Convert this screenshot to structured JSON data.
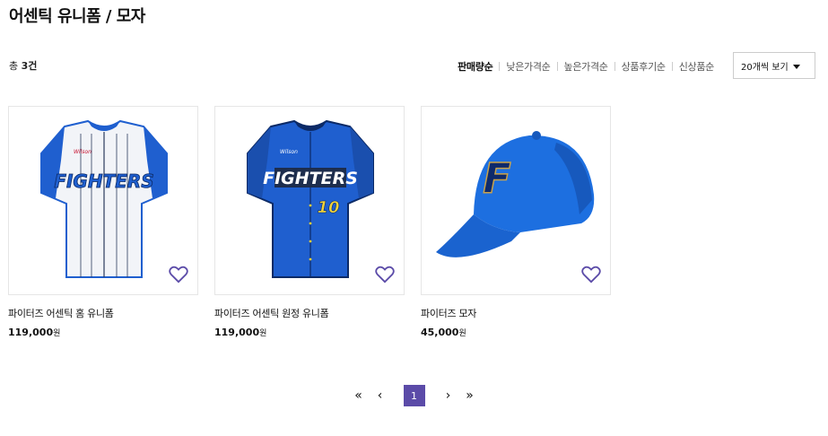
{
  "page": {
    "title": "어센틱 유니폼 / 모자"
  },
  "summary": {
    "total_prefix": "총 ",
    "total_count": "3건"
  },
  "sort": {
    "options": [
      "판매량순",
      "낮은가격순",
      "높은가격순",
      "상품후기순",
      "신상품순"
    ],
    "active": "판매량순"
  },
  "per_page": {
    "selected": "20개씩 보기"
  },
  "products": [
    {
      "name": "파이터즈 어센틱 홈 유니폼",
      "price": "119,000",
      "currency": "원",
      "image_text": "FIGHTERS",
      "brand_mark": "Wilson"
    },
    {
      "name": "파이터즈 어센틱 원정 유니폼",
      "price": "119,000",
      "currency": "원",
      "image_text": "FIGHTERS",
      "number": "10",
      "brand_mark": "Wilson"
    },
    {
      "name": "파이터즈 모자",
      "price": "45,000",
      "currency": "원",
      "image_text": "F"
    }
  ],
  "pagination": {
    "first": "«",
    "prev": "‹",
    "current": "1",
    "next": "›",
    "last": "»"
  },
  "colors": {
    "accent": "#5b4ba8",
    "jersey_blue": "#1f5fcf",
    "cap_blue": "#1d6fe0"
  }
}
